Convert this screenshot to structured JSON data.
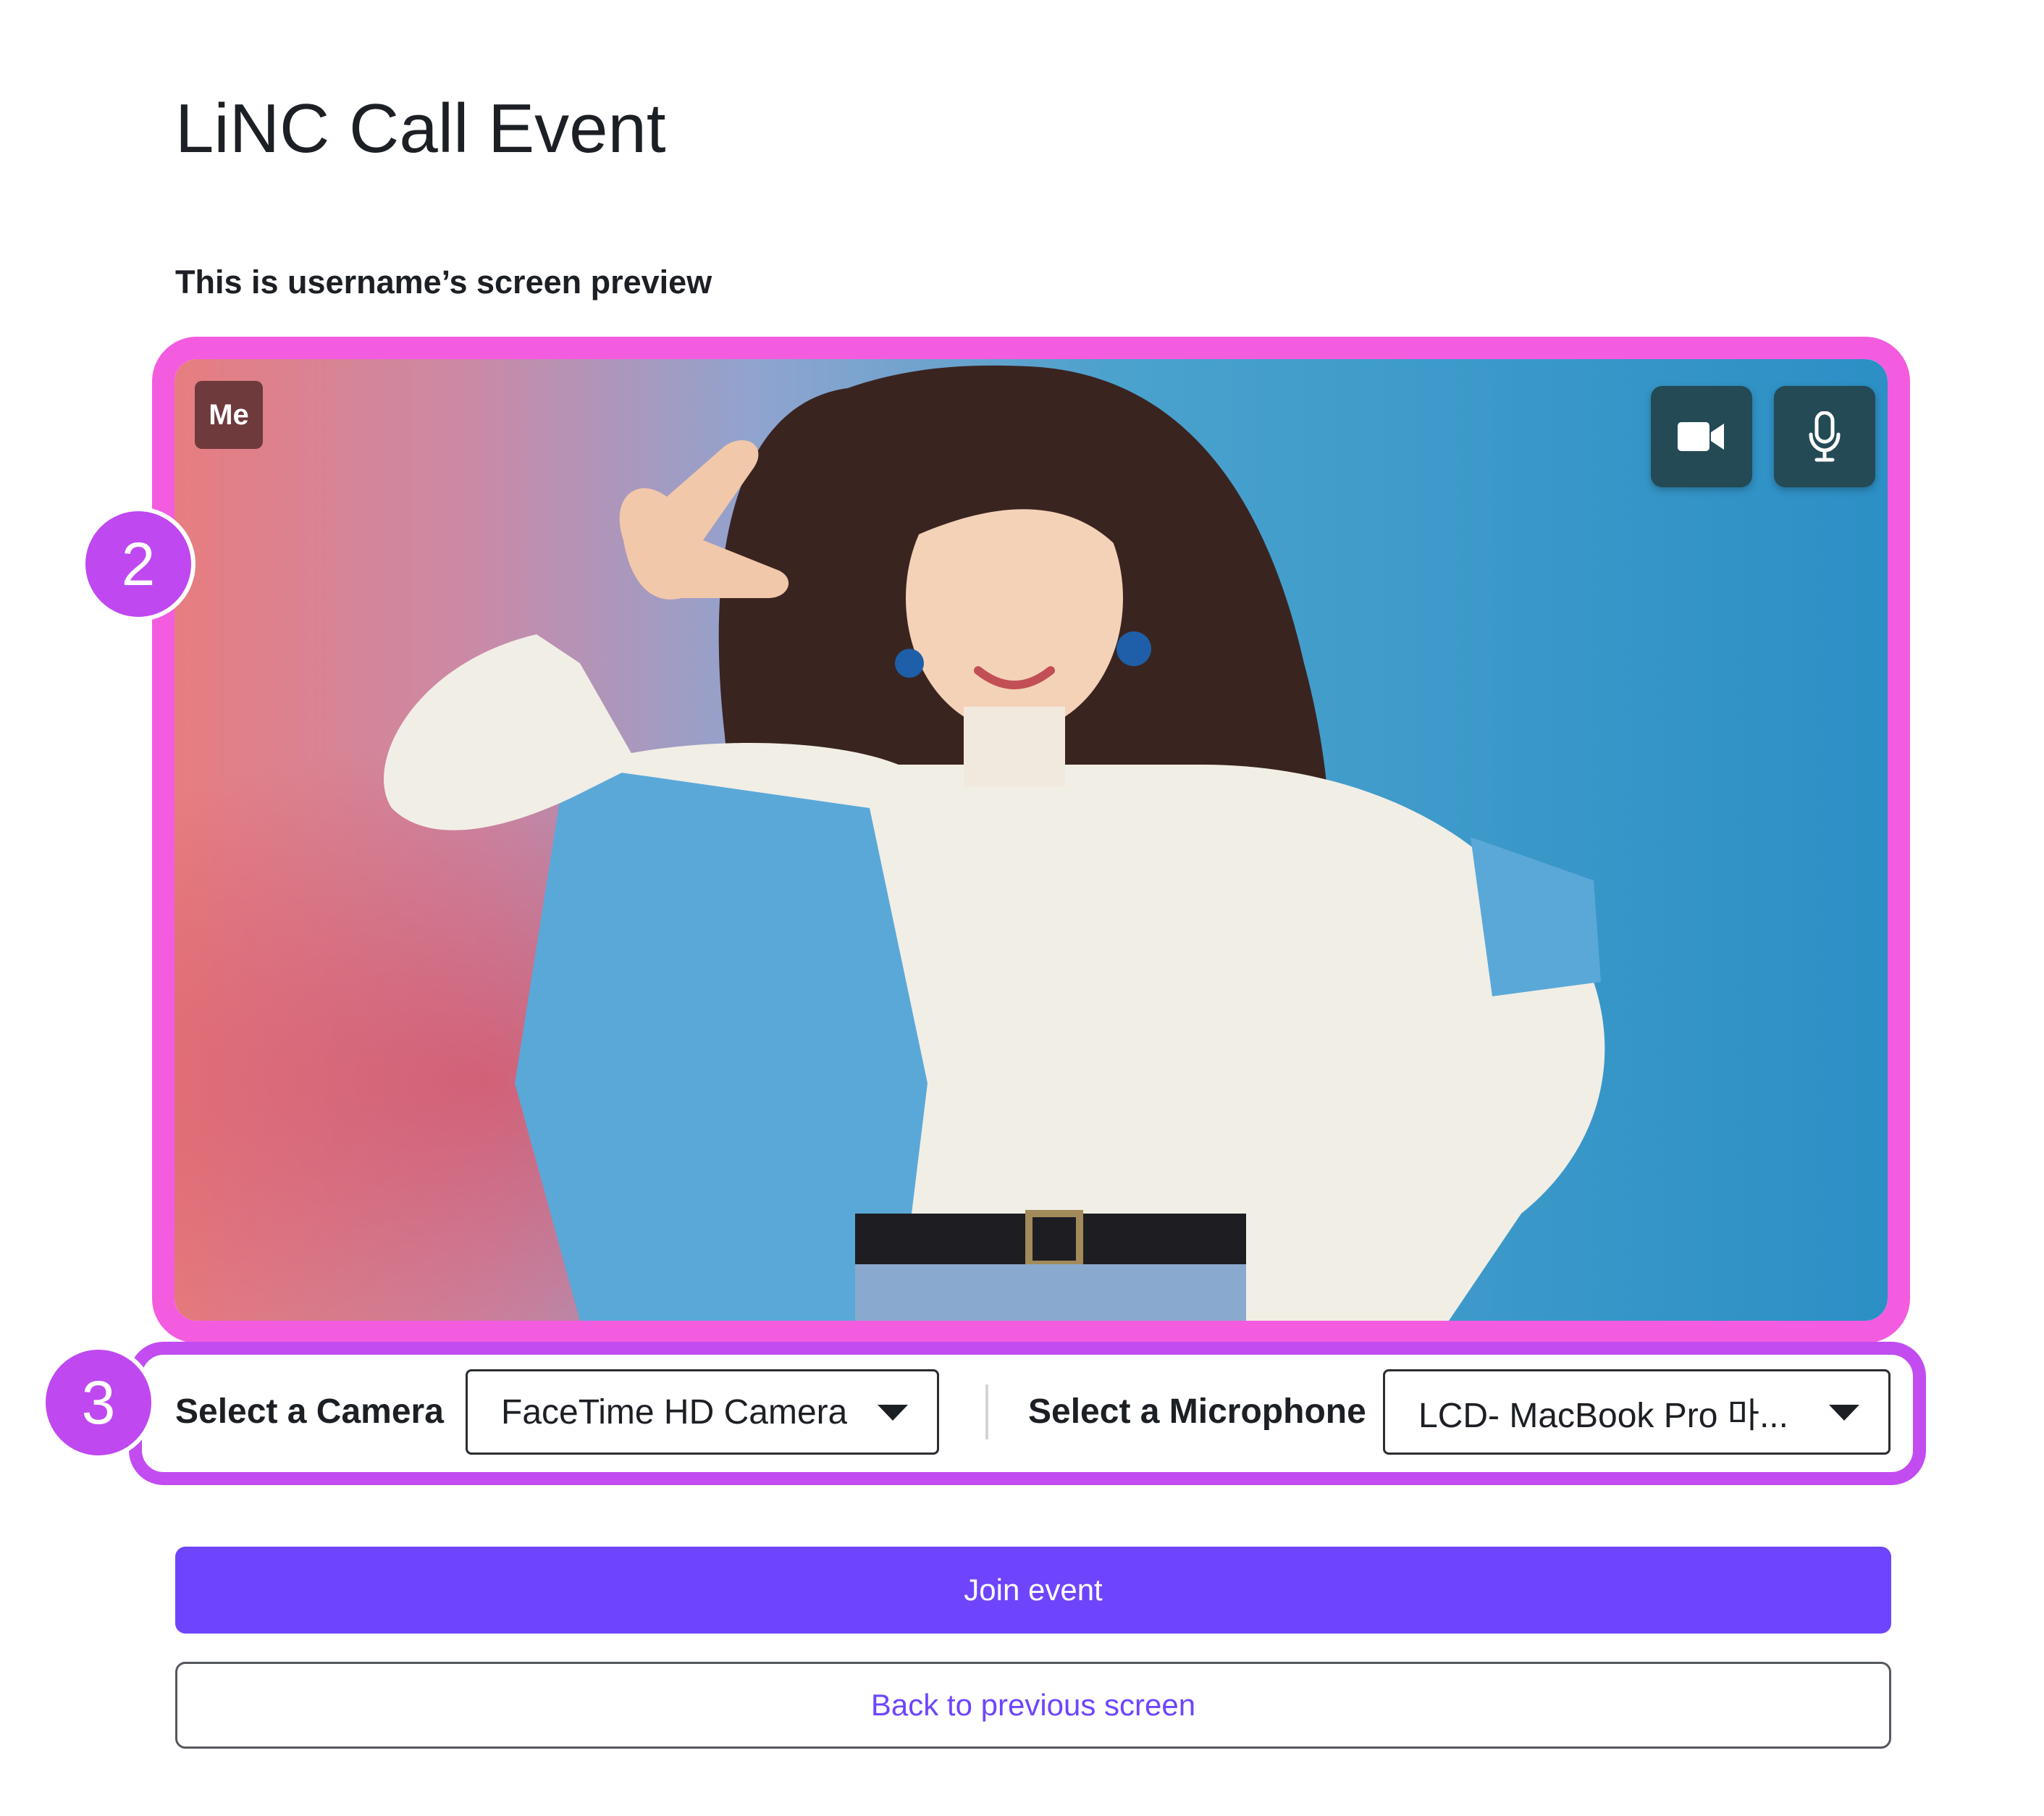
{
  "page": {
    "title": "LiNC Call Event",
    "subtitle": "This is username’s screen preview"
  },
  "preview": {
    "badge_label": "Me",
    "camera_toggle_icon": "video-camera-icon",
    "mic_toggle_icon": "microphone-icon"
  },
  "callouts": {
    "preview_number": "2",
    "devices_number": "3"
  },
  "devices": {
    "camera_label": "Select a Camera",
    "camera_value": "FaceTime HD Camera",
    "microphone_label": "Select a Microphone",
    "microphone_value": "LCD- MacBook Pro 마..."
  },
  "actions": {
    "join_label": "Join event",
    "back_label": "Back to previous screen"
  },
  "colors": {
    "accent": "#6e45fd",
    "preview_callout": "#f45ce0",
    "devices_callout": "#c24cf0",
    "toggle_bg": "#244a55",
    "me_badge_bg": "#6e3a3c"
  }
}
